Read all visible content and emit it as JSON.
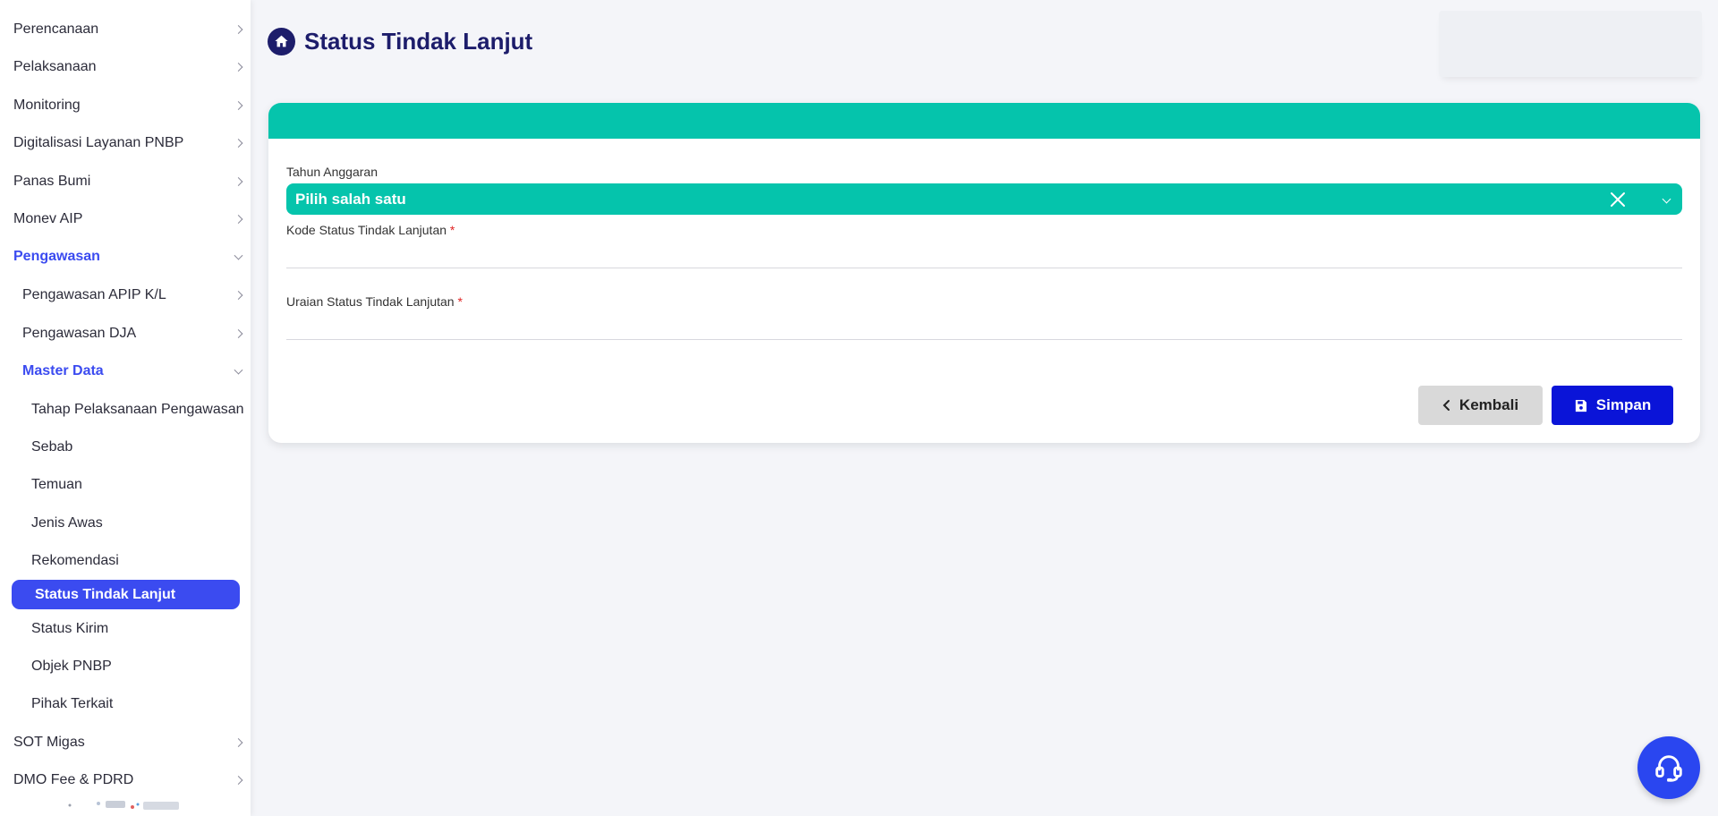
{
  "sidebar": {
    "items": [
      {
        "label": "Perencanaan"
      },
      {
        "label": "Pelaksanaan"
      },
      {
        "label": "Monitoring"
      },
      {
        "label": "Digitalisasi Layanan PNBP"
      },
      {
        "label": "Panas Bumi"
      },
      {
        "label": "Monev AIP"
      },
      {
        "label": "Pengawasan"
      },
      {
        "label": "Pengawasan APIP K/L"
      },
      {
        "label": "Pengawasan DJA"
      },
      {
        "label": "Master Data"
      },
      {
        "label": "Tahap Pelaksanaan Pengawasan"
      },
      {
        "label": "Sebab"
      },
      {
        "label": "Temuan"
      },
      {
        "label": "Jenis Awas"
      },
      {
        "label": "Rekomendasi"
      },
      {
        "label": "Status Tindak Lanjut"
      },
      {
        "label": "Status Kirim"
      },
      {
        "label": "Objek PNBP"
      },
      {
        "label": "Pihak Terkait"
      },
      {
        "label": "SOT Migas"
      },
      {
        "label": "DMO Fee & PDRD"
      }
    ]
  },
  "header": {
    "title": "Status Tindak Lanjut"
  },
  "form": {
    "tahun_label": "Tahun Anggaran",
    "tahun_value": "Pilih salah satu",
    "kode_label": "Kode Status Tindak Lanjutan",
    "uraian_label": "Uraian Status Tindak Lanjutan",
    "required_mark": "*",
    "kode_value": "",
    "uraian_value": ""
  },
  "actions": {
    "back_label": "Kembali",
    "save_label": "Simpan"
  },
  "colors": {
    "accent": "#05c4ac",
    "primary": "#0a14d8",
    "nav_active": "#3b4bf0",
    "title": "#1d1d6b"
  }
}
